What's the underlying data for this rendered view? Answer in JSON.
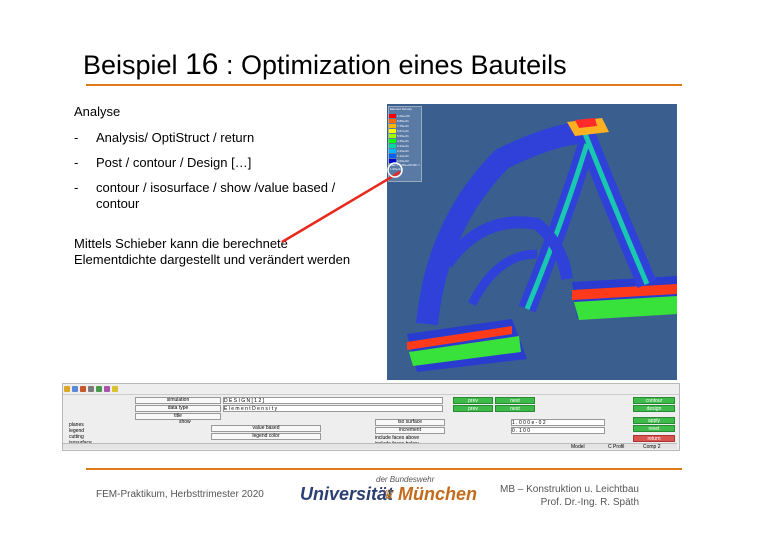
{
  "slide": {
    "title_prefix": "Beispiel ",
    "title_number": "16",
    "title_suffix": " : Optimization eines Bauteils",
    "accent_color": "#e07a1f"
  },
  "content": {
    "heading": "Analyse",
    "bullets": [
      "Analysis/ OptiStruct / return",
      "Post / contour / Design […]",
      "contour / isosurface / show /value based / contour"
    ],
    "note": "Mittels Schieber kann die berechnete Elementdichte dargestellt und verändert werden"
  },
  "viewport": {
    "legend_head": "Element Density",
    "legend_values": [
      "1.00e+00",
      "8.89e-01",
      "7.78e-01",
      "6.67e-01",
      "5.56e-01",
      "4.45e-01",
      "3.34e-01",
      "2.23e-01",
      "1.12e-01",
      "1.00e-02"
    ],
    "legend_colors": [
      "#ff0000",
      "#ff6a00",
      "#ffb400",
      "#ffff00",
      "#9cff00",
      "#00ff00",
      "#00d8a0",
      "#00b4ff",
      "#0060ff",
      "#0000d0"
    ],
    "legend_foot": "Max = 1.00e+00  Min = 1.00e-02",
    "background_color": "#3a5f8e"
  },
  "panel": {
    "simulation_label": "simulation",
    "simulation_value": "D E S I G N   [ 1 2 ]",
    "datatype_label": "data type",
    "datatype_value": "E l e m e n t   D e n s i t y",
    "title_label": "title",
    "radio_options": [
      "planes",
      "legend",
      "cutting",
      "isosurface"
    ],
    "show_label": "show",
    "value_based_label": "value based",
    "legend_color_label": "legend color",
    "iso_surface_label": "iso surface",
    "iso_value": "1 . 0 0 0 e - 0 2",
    "increment_label": "increment",
    "increment_value": "0 . 1 0 0",
    "include_above_label": "include faces above",
    "include_below_label": "include faces below",
    "prev_label": "prev",
    "next_label": "next",
    "contour_label": "contour",
    "design_label": "design",
    "apply_label": "apply",
    "reset_label": "reset",
    "return_label": "return",
    "status_model": "Model",
    "status_profile": "C Profil",
    "status_comp": "Comp 2"
  },
  "footer": {
    "left": "FEM-Praktikum, Herbsttrimester 2020",
    "logo_top": "der Bundeswehr",
    "logo_left": "Universität",
    "logo_right": "München",
    "right_line1": "MB – Konstruktion u. Leichtbau",
    "right_line2": "Prof. Dr.-Ing. R. Späth"
  }
}
